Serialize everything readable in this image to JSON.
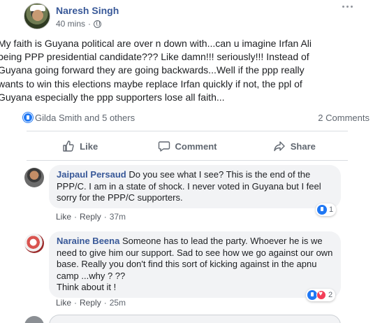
{
  "post": {
    "author": "Naresh Singh",
    "time": "40 mins",
    "separator": "·",
    "text_lines": [
      "My faith is Guyana political are over n down with...can u imagine Irfan Ali",
      "being PPP presidential candidate??? Like damn!!! seriously!!! Instead of",
      "Guyana going forward they are going backwards...Well if the ppp really",
      "wants to win this elections maybe replace Irfan quickly if not, the ppl of",
      "Guyana especially the ppp supporters lose all faith..."
    ]
  },
  "reactions": {
    "reactors": "Gilda Smith and 5 others",
    "comment_count": "2 Comments"
  },
  "actions": {
    "like": "Like",
    "comment": "Comment",
    "share": "Share"
  },
  "comments": [
    {
      "name": "Jaipaul Persaud",
      "lines": [
        " Do you see what I see? This is the end of the",
        "PPP/C. I am in a state of shock. I never voted in Guyana but I feel",
        "sorry for the PPP/C supporters."
      ],
      "like": "Like",
      "reply": "Reply",
      "dot": "·",
      "time": "37m",
      "reaction_count": "1"
    },
    {
      "name": "Naraine Beena",
      "lines": [
        " Someone has to lead the party. Whoever he is we",
        "need to give him our support. Sad to see how we go against our own",
        "base. Really you don't find this sort of kicking against in the apnu",
        "camp ...why ? ??",
        "Think about it !"
      ],
      "like": "Like",
      "reply": "Reply",
      "dot": "·",
      "time": "25m",
      "reaction_count": "2"
    }
  ],
  "colors": {
    "name_blue": "#385898",
    "meta_gray": "#606770",
    "bubble_bg": "#f2f3f5",
    "like_blue": "#2078f4",
    "love_red": "#f33e58"
  }
}
